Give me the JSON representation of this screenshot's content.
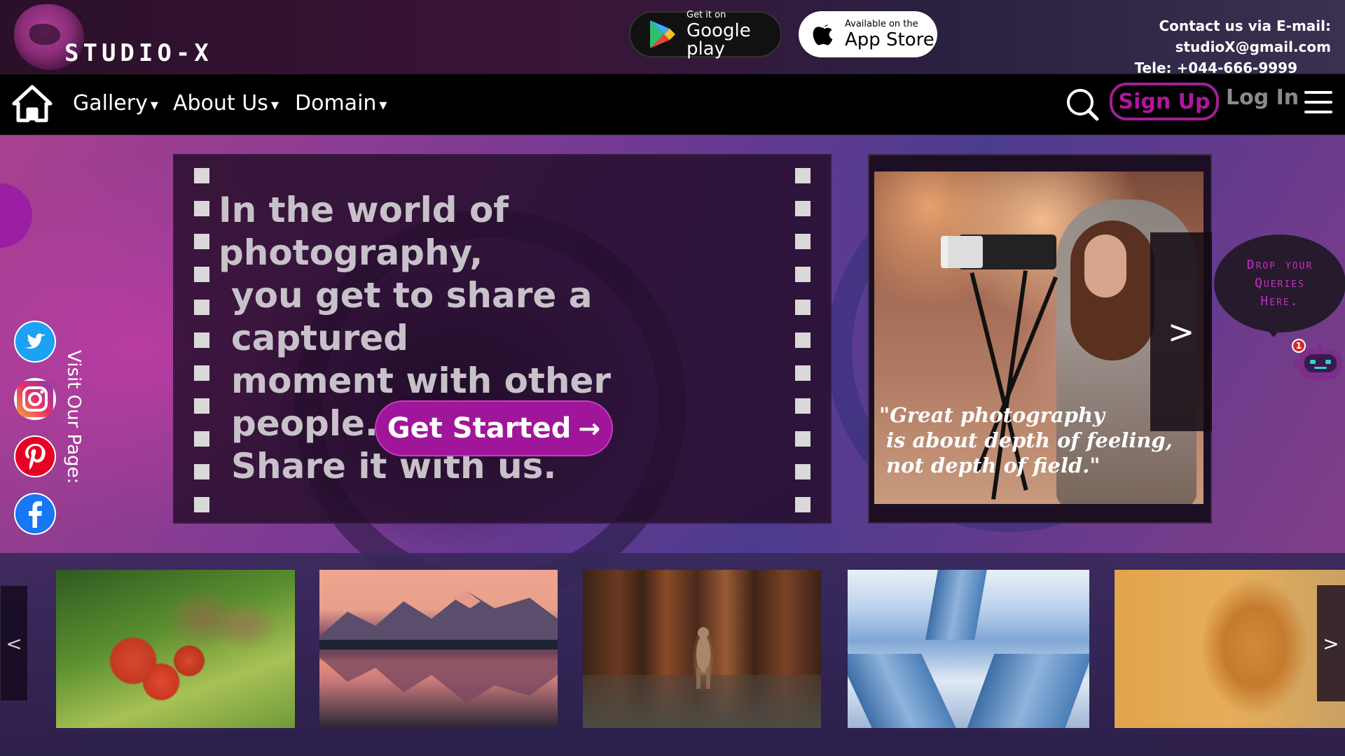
{
  "brand": {
    "name": "STUDIO-X",
    "accent": "#a0169a"
  },
  "header": {
    "google_badge": {
      "small": "Get it on",
      "big": "Google play"
    },
    "apple_badge": {
      "small": "Available on the",
      "big": "App Store"
    },
    "contact_email_line": "Contact us via E-mail: studioX@gmail.com",
    "contact_phone_line": "Tele: +044-666-9999"
  },
  "nav": {
    "home_icon": "home-icon",
    "items": [
      {
        "label": "Gallery",
        "caret": "▾"
      },
      {
        "label": "About Us",
        "caret": "▾"
      },
      {
        "label": "Domain",
        "caret": "▾"
      }
    ],
    "search_icon": "search-icon",
    "signup_label": "Sign Up",
    "login_label": "Log In",
    "menu_icon": "hamburger-menu-icon"
  },
  "social": {
    "label": "Visit Our Page:",
    "icons": [
      "twitter-icon",
      "instagram-icon",
      "pinterest-icon",
      "facebook-icon"
    ]
  },
  "hero": {
    "lines": [
      "In the world of photography,",
      "you get to share a captured",
      "moment with other people...",
      "Share it with us."
    ],
    "cta_label": "Get Started",
    "cta_arrow": "→"
  },
  "feature": {
    "quote_lines": [
      "\"Great photography",
      "is about depth of feeling,",
      "not depth of field.\""
    ],
    "next_label": ">"
  },
  "chat": {
    "lines": [
      "Drop your",
      "Queries",
      "Here."
    ],
    "badge_count": "1"
  },
  "gallery_strip": {
    "prev_label": "<",
    "next_label": ">",
    "thumbnails": [
      "birds-photo",
      "mountain-lake-photo",
      "kangaroo-forest-photo",
      "skyscrapers-photo",
      "cheetah-photo"
    ]
  }
}
